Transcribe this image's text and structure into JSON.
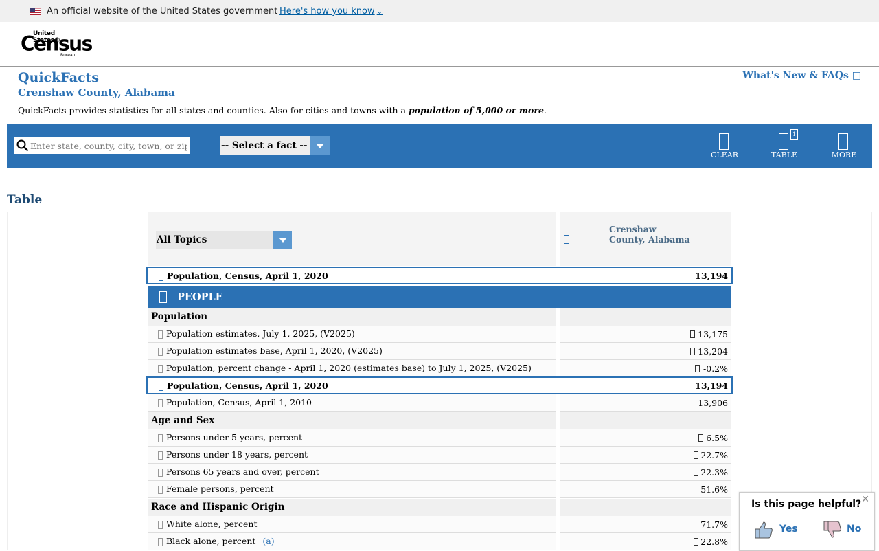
{
  "gov_banner": {
    "text": "An official website of the United States government",
    "link": "Here's how you know"
  },
  "logo": {
    "line1": "United States®",
    "line2": "Census",
    "line3": "Bureau"
  },
  "quickfacts": {
    "title": "QuickFacts",
    "location": "Crenshaw County, Alabama",
    "description_prefix": "QuickFacts provides statistics for all states and counties. Also for cities and towns with a ",
    "description_bold": "population of 5,000 or more",
    "description_suffix": ".",
    "whats_new": "What's New & FAQs □"
  },
  "toolbar": {
    "search_placeholder": "Enter state, county, city, town, or zip code",
    "fact_select": "-- Select a fact --",
    "clear": "CLEAR",
    "table": "TABLE",
    "table_badge": "1",
    "more": "MORE"
  },
  "section_title": "Table",
  "table": {
    "topic_select": "All Topics",
    "column_header": "Crenshaw County, Alabama",
    "pinned_row": {
      "label": "Population, Census, April 1, 2020",
      "value": "13,194"
    },
    "people_label": "PEOPLE",
    "groups": {
      "population": "Population",
      "age_sex": "Age and Sex",
      "race": "Race and Hispanic Origin"
    },
    "rows": [
      {
        "label": "Population estimates, July 1, 2025, (V2025)",
        "value": "13,175"
      },
      {
        "label": "Population estimates base, April 1, 2020, (V2025)",
        "value": "13,204"
      },
      {
        "label": "Population, percent change - April 1, 2020 (estimates base) to July 1, 2025, (V2025)",
        "value": "-0.2%"
      },
      {
        "label": "Population, Census, April 1, 2020",
        "value": "13,194"
      },
      {
        "label": "Population, Census, April 1, 2010",
        "value": "13,906"
      },
      {
        "label": "Persons under 5 years, percent",
        "value": "6.5%"
      },
      {
        "label": "Persons under 18 years, percent",
        "value": "22.7%"
      },
      {
        "label": "Persons 65 years and over, percent",
        "value": "22.3%"
      },
      {
        "label": "Female persons, percent",
        "value": "51.6%"
      },
      {
        "label": "White alone, percent",
        "value": "71.7%"
      },
      {
        "label": "Black alone, percent",
        "value": "22.8%",
        "footnote": "(a)"
      }
    ]
  },
  "feedback": {
    "question": "Is this page helpful?",
    "yes": "Yes",
    "no": "No",
    "close": "✕"
  }
}
